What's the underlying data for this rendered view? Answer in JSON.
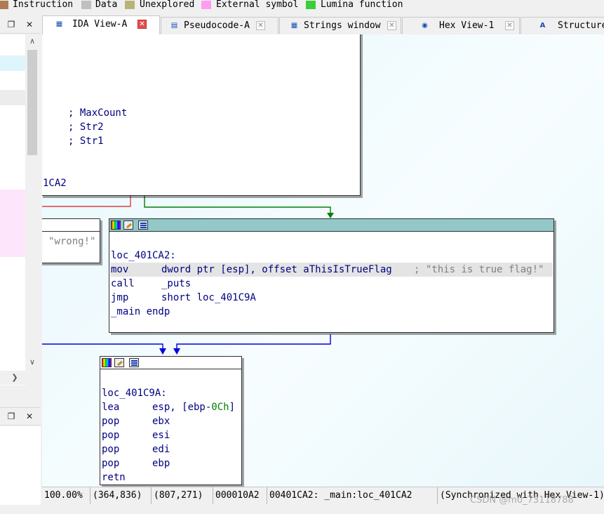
{
  "legend": {
    "items": [
      {
        "label": "Instruction",
        "color": "#b07b52"
      },
      {
        "label": "Data",
        "color": "#c0c0c0"
      },
      {
        "label": "Unexplored",
        "color": "#b8b478"
      },
      {
        "label": "External symbol",
        "color": "#ff9cf0"
      },
      {
        "label": "Lumina function",
        "color": "#3ccc3c"
      }
    ]
  },
  "left_panel": {
    "restore_glyph": "❐",
    "close_glyph": "✕",
    "scroll_up": "∧",
    "scroll_down": "∨",
    "scroll_right": "❯"
  },
  "tabs": [
    {
      "label": "IDA View-A",
      "icon": "graph-view-icon",
      "active": true
    },
    {
      "label": "Pseudocode-A",
      "icon": "pseudocode-icon",
      "active": false
    },
    {
      "label": "Strings window",
      "icon": "strings-icon",
      "active": false
    },
    {
      "label": "Hex View-1",
      "icon": "hex-view-icon",
      "active": false
    },
    {
      "label": "Structure",
      "icon": "structures-icon",
      "active": false
    }
  ],
  "tab_close_glyph": "✕",
  "graph": {
    "top_node": {
      "fragment": "''",
      "comments": [
        "; MaxCount",
        "; Str2",
        "; Str1"
      ],
      "bottom_label": "1CA2"
    },
    "wrong_node": {
      "text": "\"wrong!\""
    },
    "true_node": {
      "label": "loc_401CA2:",
      "lines": [
        {
          "mnem": "mov",
          "ops": "dword ptr [esp], offset aThisIsTrueFlag",
          "comment": "; \"this is true flag!\""
        },
        {
          "mnem": "call",
          "ops": "_puts",
          "comment": ""
        },
        {
          "mnem": "jmp",
          "ops": "short loc_401C9A",
          "comment": ""
        }
      ],
      "endp": "_main endp"
    },
    "exit_node": {
      "label": "loc_401C9A:",
      "lines": [
        {
          "mnem": "lea",
          "ops_pre": "esp, [ebp-",
          "ops_num": "0Ch",
          "ops_post": "]"
        },
        {
          "mnem": "pop",
          "ops_pre": "ebx",
          "ops_num": "",
          "ops_post": ""
        },
        {
          "mnem": "pop",
          "ops_pre": "esi",
          "ops_num": "",
          "ops_post": ""
        },
        {
          "mnem": "pop",
          "ops_pre": "edi",
          "ops_num": "",
          "ops_post": ""
        },
        {
          "mnem": "pop",
          "ops_pre": "ebp",
          "ops_num": "",
          "ops_post": ""
        },
        {
          "mnem": "retn",
          "ops_pre": "",
          "ops_num": "",
          "ops_post": ""
        }
      ]
    },
    "colors": {
      "edge_false": "#e04040",
      "edge_true": "#008000",
      "edge_jump": "#0000e0",
      "title_teal": "#92c8c8"
    }
  },
  "status": {
    "zoom": "100.00%",
    "pos1": "(364,836)",
    "pos2": "(807,271)",
    "offset": "000010A2",
    "location": "00401CA2: _main:loc_401CA2",
    "sync": "(Synchronized with Hex View-1)"
  },
  "watermark": "CSDN @m0_73118788"
}
